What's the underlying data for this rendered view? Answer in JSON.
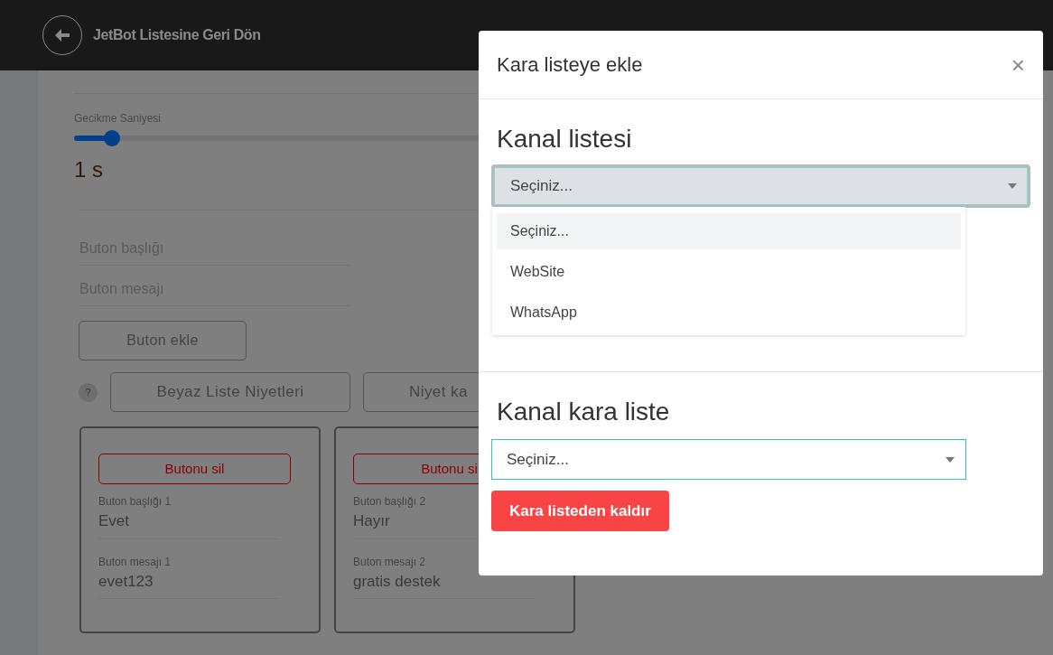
{
  "header": {
    "back_label": "JetBot Listesine Geri Dön"
  },
  "delay": {
    "label": "Gecikme Saniyesi",
    "level": 0.094,
    "reading": "1 s"
  },
  "button_form": {
    "title_placeholder": "Buton başlığı",
    "message_placeholder": "Buton mesajı",
    "add_button": "Buton ekle",
    "help": "?",
    "actions": [
      "Beyaz Liste Niyetleri",
      "Niyet ka"
    ]
  },
  "cards": [
    {
      "delete": "Butonu sil",
      "title_label": "Buton başlığı 1",
      "title_value": "Evet",
      "message_label": "Buton mesajı 1",
      "message_value": "evet123"
    },
    {
      "delete": "Butonu si",
      "title_label": "Buton başlığı 2",
      "title_value": "Hayır",
      "message_label": "Buton mesajı 2",
      "message_value": "gratis destek"
    }
  ],
  "modal": {
    "title": "Kara listeye ekle",
    "close": "×",
    "channel_list": {
      "heading": "Kanal listesi",
      "value": "Seçiniz...",
      "expanded": true,
      "options": [
        {
          "label": "Seçiniz...",
          "selected": true
        },
        {
          "label": "WebSite",
          "selected": false
        },
        {
          "label": "WhatsApp",
          "selected": false
        }
      ]
    },
    "channel_blacklist": {
      "heading": "Kanal kara liste",
      "value": "Seçiniz...",
      "expanded": false,
      "action": "Kara listeden kaldır"
    }
  }
}
